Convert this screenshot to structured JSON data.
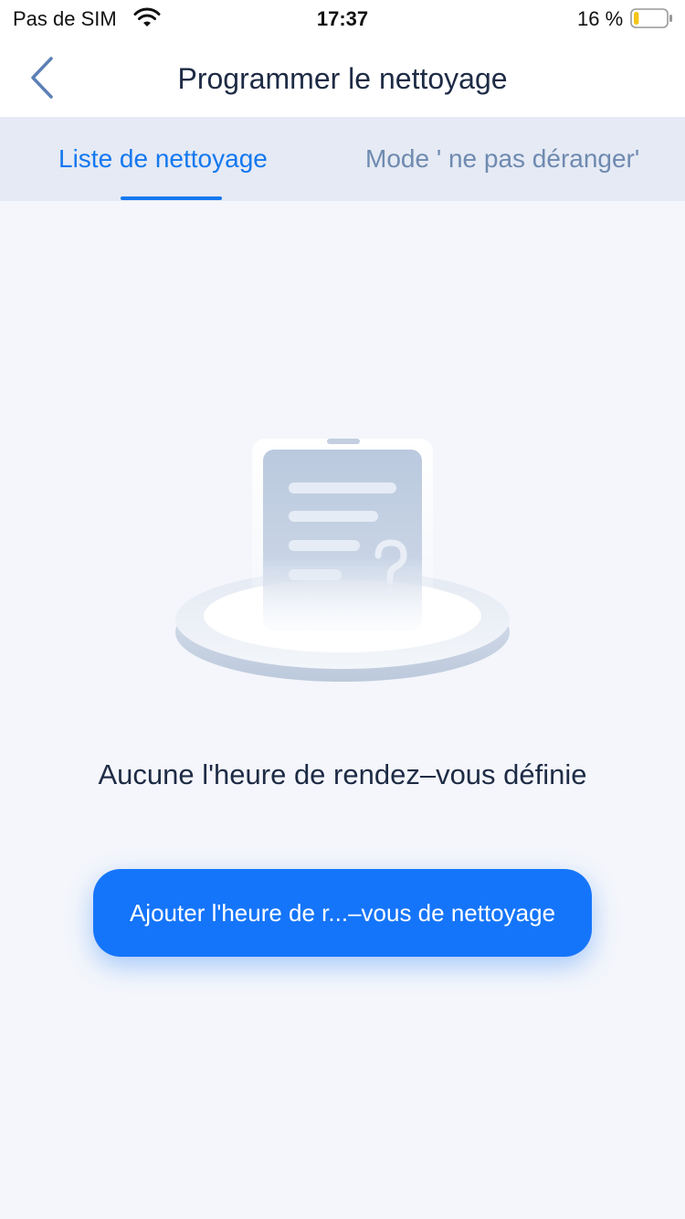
{
  "status_bar": {
    "carrier": "Pas de SIM",
    "time": "17:37",
    "battery_percent": "16 %",
    "battery_level": 0.16,
    "wifi_icon": "wifi-icon",
    "battery_icon": "battery-icon"
  },
  "nav": {
    "title": "Programmer le nettoyage",
    "back_icon": "chevron-left-icon"
  },
  "tabs": [
    {
      "label": "Liste de nettoyage",
      "active": true
    },
    {
      "label": "Mode ' ne pas déranger'",
      "active": false
    }
  ],
  "empty_state": {
    "illustration_icon": "empty-list-question-icon",
    "message": "Aucune l'heure de rendez–vous définie"
  },
  "add_button": {
    "label": "Ajouter l'heure de r...–vous de nettoyage"
  },
  "colors": {
    "accent": "#1478F0",
    "button": "#1575FA",
    "tab_bar": "#E5EAF4",
    "background": "#F4F6FB",
    "battery_low": "#F5C518"
  }
}
